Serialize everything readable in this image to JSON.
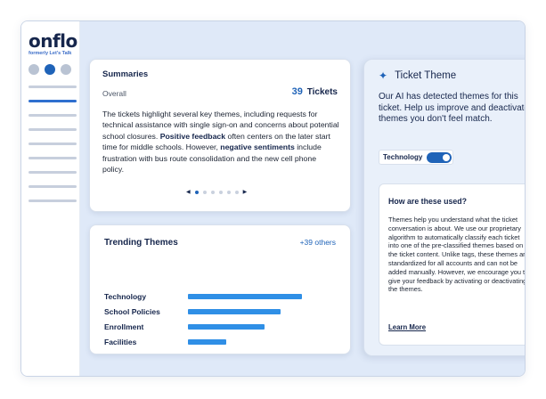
{
  "brand": {
    "name": "onflo",
    "subtitle": "formerly Let's Talk"
  },
  "sidebar": {
    "active_dot": 1,
    "dot_count": 3,
    "nav_count": 9,
    "active_nav": 1
  },
  "summaries": {
    "title": "Summaries",
    "overall_label": "Overall",
    "count": "39",
    "count_unit": "Tickets",
    "text_1": "The tickets highlight several key themes, including requests for technical assistance with single sign-on and concerns about potential school closures. ",
    "bold_1": "Positive feedback",
    "text_2": " often centers on the later start time for middle schools. However, ",
    "bold_2": "negative sentiments",
    "text_3": " include frustration with bus route consolidation and the new cell phone policy.",
    "pager": {
      "prev": "◀",
      "next": "▶",
      "page_count": 6,
      "active_page": 0
    }
  },
  "trending": {
    "title": "Trending Themes",
    "others": "+39 others",
    "themes": [
      {
        "label": "Technology",
        "value": 0.8
      },
      {
        "label": "School Policies",
        "value": 0.65
      },
      {
        "label": "Enrollment",
        "value": 0.54
      },
      {
        "label": "Facilities",
        "value": 0.27
      }
    ]
  },
  "panel": {
    "sparkle_icon": "✦",
    "title": "Ticket Theme",
    "description": "Our AI has detected themes for this ticket. Help us improve and deactivate themes you don't feel match.",
    "tag": {
      "label": "Technology",
      "enabled": true
    },
    "info": {
      "title": "How are these used?",
      "text": "Themes help you understand what the ticket conversation is about. We use our proprietary algorithm to automatically classify each ticket into one of the pre-classified themes based on the ticket content. Unlike tags, these themes are standardized for all accounts and can not be added manually. However, we encourage you to give your feedback by activating or deactivating the themes.",
      "link": "Learn More"
    }
  }
}
